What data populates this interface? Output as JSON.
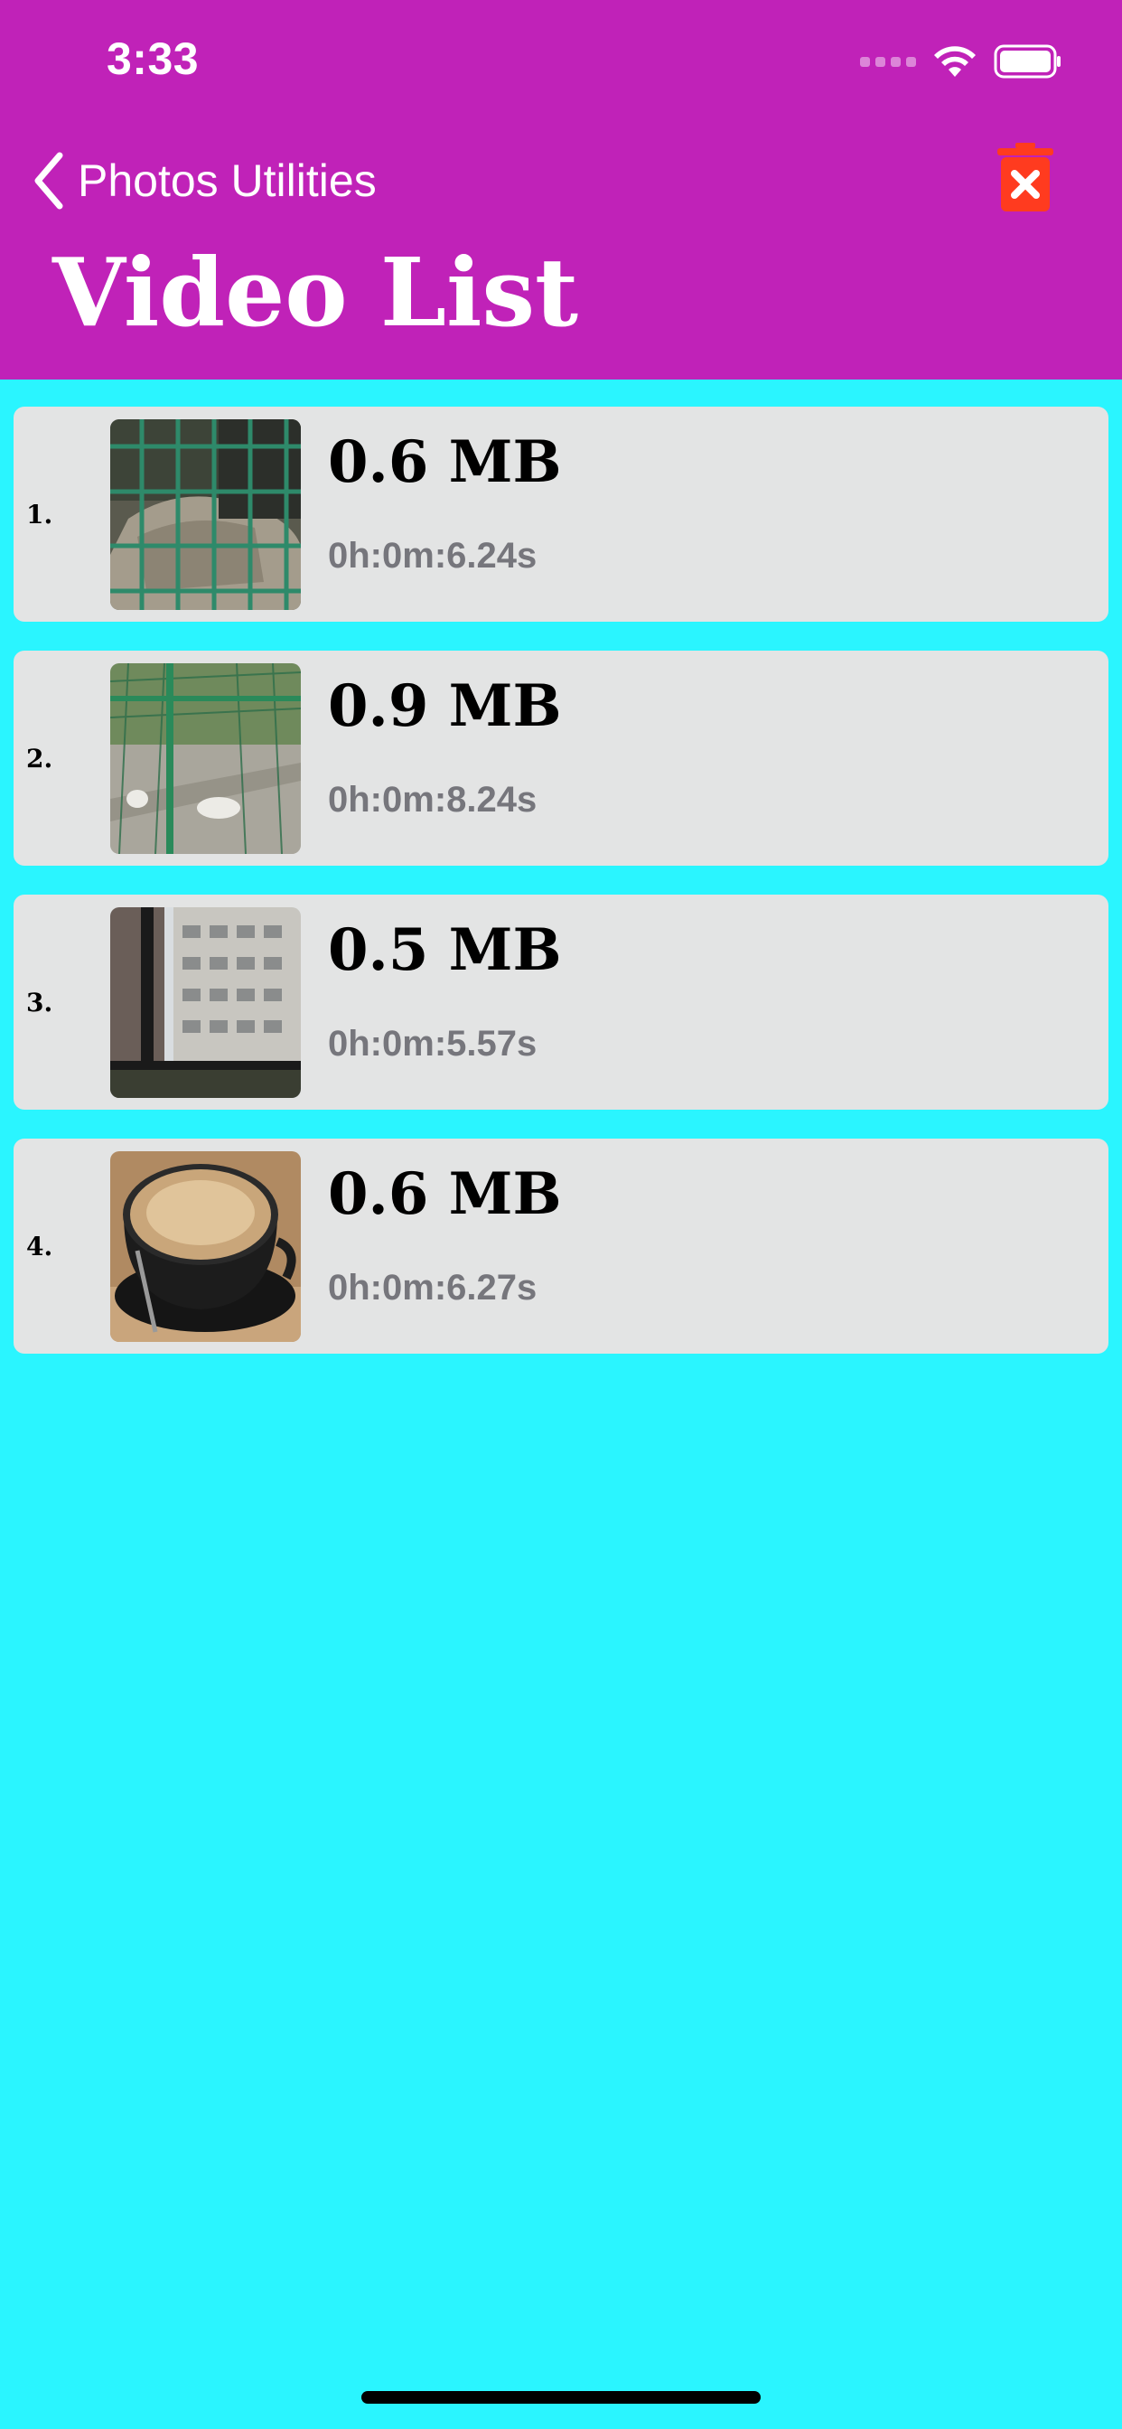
{
  "status_bar": {
    "time": "3:33"
  },
  "nav": {
    "back_label": "Photos Utilities",
    "title": "Video List",
    "delete_icon": "trash-delete-icon"
  },
  "colors": {
    "header_bg": "#C022B8",
    "page_bg": "#2AF5FF",
    "row_bg": "#E3E4E4",
    "trash": "#FF3B1F",
    "duration_text": "#76767C"
  },
  "videos": [
    {
      "index": "1.",
      "size": "0.6 MB",
      "duration": "0h:0m:6.24s",
      "thumbnail": "fence-rock-thumbnail"
    },
    {
      "index": "2.",
      "size": "0.9 MB",
      "duration": "0h:0m:8.24s",
      "thumbnail": "rabbits-enclosure-thumbnail"
    },
    {
      "index": "3.",
      "size": "0.5 MB",
      "duration": "0h:0m:5.57s",
      "thumbnail": "buildings-window-thumbnail"
    },
    {
      "index": "4.",
      "size": "0.6 MB",
      "duration": "0h:0m:6.27s",
      "thumbnail": "coffee-cup-thumbnail"
    }
  ]
}
